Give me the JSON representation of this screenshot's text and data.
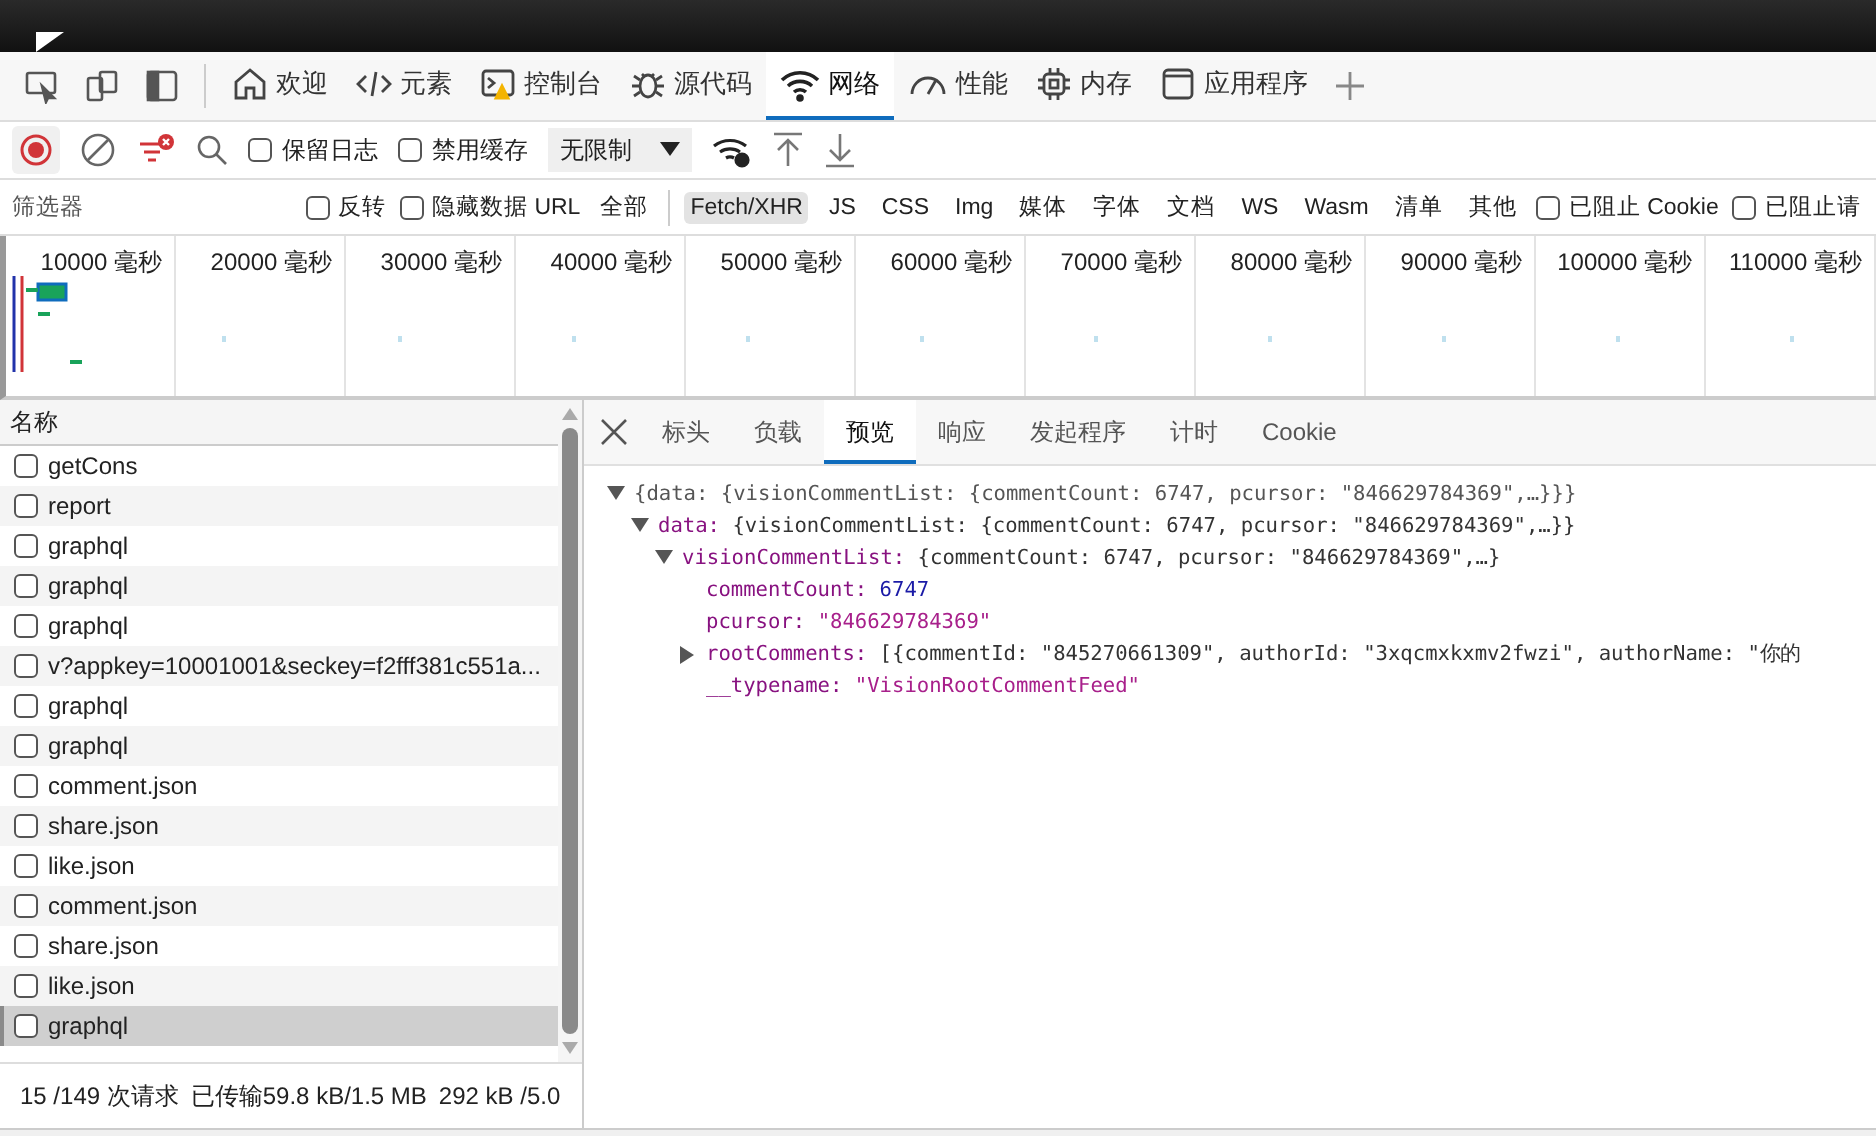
{
  "main_tabs": [
    {
      "label": "欢迎",
      "selected": false
    },
    {
      "label": "元素",
      "selected": false
    },
    {
      "label": "控制台",
      "selected": false
    },
    {
      "label": "源代码",
      "selected": false
    },
    {
      "label": "网络",
      "selected": true
    },
    {
      "label": "性能",
      "selected": false
    },
    {
      "label": "内存",
      "selected": false
    },
    {
      "label": "应用程序",
      "selected": false
    }
  ],
  "toolbar": {
    "recording": true,
    "options": [
      {
        "label": "保留日志",
        "checked": false
      },
      {
        "label": "禁用缓存",
        "checked": false
      }
    ],
    "throttle": "无限制"
  },
  "filter": {
    "placeholder": "筛选器",
    "checks": [
      {
        "label": "反转",
        "checked": false
      },
      {
        "label": "隐藏数据 URL",
        "checked": false
      }
    ],
    "types": [
      {
        "label": "全部",
        "selected": false
      },
      {
        "label": "Fetch/XHR",
        "selected": true
      },
      {
        "label": "JS",
        "selected": false
      },
      {
        "label": "CSS",
        "selected": false
      },
      {
        "label": "Img",
        "selected": false
      },
      {
        "label": "媒体",
        "selected": false
      },
      {
        "label": "字体",
        "selected": false
      },
      {
        "label": "文档",
        "selected": false
      },
      {
        "label": "WS",
        "selected": false
      },
      {
        "label": "Wasm",
        "selected": false
      },
      {
        "label": "清单",
        "selected": false
      },
      {
        "label": "其他",
        "selected": false
      }
    ],
    "blocked": [
      {
        "label": "已阻止 Cookie",
        "checked": false
      },
      {
        "label": "已阻止请",
        "checked": false
      }
    ]
  },
  "timeline": {
    "ticks": [
      "10000 毫秒",
      "20000 毫秒",
      "30000 毫秒",
      "40000 毫秒",
      "50000 毫秒",
      "60000 毫秒",
      "70000 毫秒",
      "80000 毫秒",
      "90000 毫秒",
      "100000 毫秒",
      "110000 毫秒"
    ]
  },
  "requests": {
    "column": "名称",
    "rows": [
      {
        "name": "getCons",
        "checked": false,
        "selected": false
      },
      {
        "name": "report",
        "checked": false,
        "selected": false
      },
      {
        "name": "graphql",
        "checked": false,
        "selected": false
      },
      {
        "name": "graphql",
        "checked": false,
        "selected": false
      },
      {
        "name": "graphql",
        "checked": false,
        "selected": false
      },
      {
        "name": "v?appkey=10001001&seckey=f2fff381c551a...",
        "checked": false,
        "selected": false
      },
      {
        "name": "graphql",
        "checked": false,
        "selected": false
      },
      {
        "name": "graphql",
        "checked": false,
        "selected": false
      },
      {
        "name": "comment.json",
        "checked": false,
        "selected": false
      },
      {
        "name": "share.json",
        "checked": false,
        "selected": false
      },
      {
        "name": "like.json",
        "checked": false,
        "selected": false
      },
      {
        "name": "comment.json",
        "checked": false,
        "selected": false
      },
      {
        "name": "share.json",
        "checked": false,
        "selected": false
      },
      {
        "name": "like.json",
        "checked": false,
        "selected": false
      },
      {
        "name": "graphql",
        "checked": false,
        "selected": true
      }
    ]
  },
  "status_bar": [
    "15 /149 次请求",
    "已传输59.8 kB/1.5 MB",
    "292 kB /5.0"
  ],
  "detail_tabs": [
    {
      "label": "标头",
      "selected": false
    },
    {
      "label": "负载",
      "selected": false
    },
    {
      "label": "预览",
      "selected": true
    },
    {
      "label": "响应",
      "selected": false
    },
    {
      "label": "发起程序",
      "selected": false
    },
    {
      "label": "计时",
      "selected": false
    },
    {
      "label": "Cookie",
      "selected": false
    }
  ],
  "preview": [
    {
      "value": "{data: {visionCommentList: {commentCount: 6747, pcursor: \"846629784369\",…}}}",
      "kind": "object",
      "expanded": true,
      "children": [
        {
          "key": "data:",
          "value": "{visionCommentList: {commentCount: 6747, pcursor: \"846629784369\",…}}",
          "kind": "object",
          "expanded": true,
          "children": [
            {
              "key": "visionCommentList:",
              "value": "{commentCount: 6747, pcursor: \"846629784369\",…}",
              "kind": "object",
              "expanded": true,
              "children": [
                {
                  "key": "commentCount:",
                  "value": "6747",
                  "kind": "number"
                },
                {
                  "key": "pcursor:",
                  "value": "\"846629784369\"",
                  "kind": "string"
                },
                {
                  "key": "rootComments:",
                  "value": "[{commentId: \"845270661309\", authorId: \"3xqcmxkxmv2fwzi\", authorName: \"你的",
                  "kind": "object",
                  "expanded": false
                },
                {
                  "key": "__typename:",
                  "value": "\"VisionRootCommentFeed\"",
                  "kind": "string"
                }
              ]
            }
          ]
        }
      ]
    }
  ]
}
